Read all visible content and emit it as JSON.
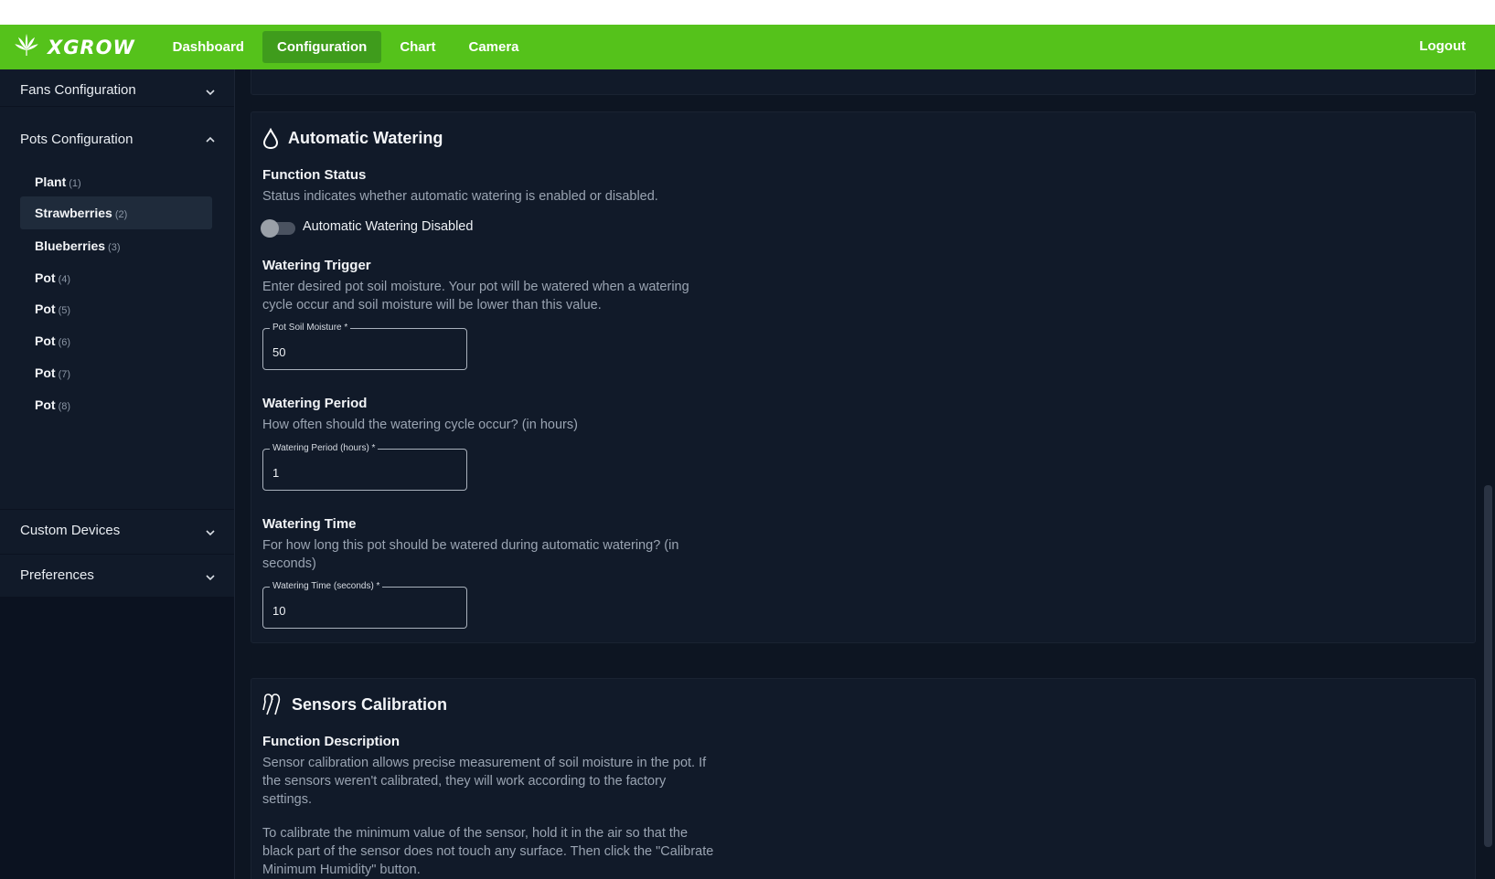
{
  "app": {
    "brand": "XGROW"
  },
  "nav": {
    "items": [
      {
        "label": "Dashboard",
        "active": false
      },
      {
        "label": "Configuration",
        "active": true
      },
      {
        "label": "Chart",
        "active": false
      },
      {
        "label": "Camera",
        "active": false
      }
    ],
    "logout": "Logout"
  },
  "sidebar": {
    "fans": "Fans Configuration",
    "pots": "Pots Configuration",
    "pot_items": [
      {
        "name": "Plant",
        "count": "(1)"
      },
      {
        "name": "Strawberries",
        "count": "(2)"
      },
      {
        "name": "Blueberries",
        "count": "(3)"
      },
      {
        "name": "Pot",
        "count": "(4)"
      },
      {
        "name": "Pot",
        "count": "(5)"
      },
      {
        "name": "Pot",
        "count": "(6)"
      },
      {
        "name": "Pot",
        "count": "(7)"
      },
      {
        "name": "Pot",
        "count": "(8)"
      }
    ],
    "selected_pot": "Strawberries",
    "custom_devices": "Custom Devices",
    "preferences": "Preferences"
  },
  "watering": {
    "title": "Automatic Watering",
    "status_title": "Function Status",
    "status_desc": "Status indicates whether automatic watering is enabled or disabled.",
    "toggle_label": "Automatic Watering Disabled",
    "toggle_on": false,
    "trigger_title": "Watering Trigger",
    "trigger_desc": "Enter desired pot soil moisture. Your pot will be watered when a watering cycle occur and soil moisture will be lower than this value.",
    "moisture_label": "Pot Soil Moisture *",
    "moisture_value": "50",
    "period_title": "Watering Period",
    "period_desc": "How often should the watering cycle occur? (in hours)",
    "period_label": "Watering Period (hours) *",
    "period_value": "1",
    "time_title": "Watering Time",
    "time_desc": "For how long this pot should be watered during automatic watering? (in seconds)",
    "time_label": "Watering Time (seconds) *",
    "time_value": "10"
  },
  "calibration": {
    "title": "Sensors Calibration",
    "desc_title": "Function Description",
    "desc_1": "Sensor calibration allows precise measurement of soil moisture in the pot. If the sensors weren't calibrated, they will work according to the factory settings.",
    "desc_2": "To calibrate the minimum value of the sensor, hold it in the air so that the black part of the sensor does not touch any surface. Then click the \"Calibrate Minimum Humidity\" button."
  },
  "colors": {
    "accent": "#55c21b",
    "accent_active": "#3f9c1c",
    "background": "#0d1522",
    "card": "#111a29"
  },
  "icons": {
    "brand": "cannabis-leaf-icon",
    "watering": "water-drop-icon",
    "calibration": "sensor-probe-icon",
    "chevron": "chevron-icon"
  }
}
